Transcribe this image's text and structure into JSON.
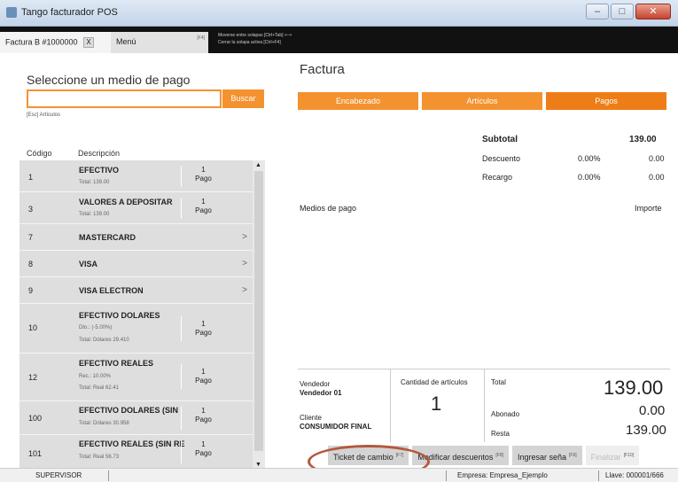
{
  "window": {
    "title": "Tango facturador POS",
    "buttons": [
      "–",
      "□",
      "✕"
    ]
  },
  "tabs": {
    "active_label": "Factura B #1000000",
    "close_glyph": "X",
    "menu_label": "Menú",
    "menu_key": "[F4]",
    "hint_line1": "Moverse entre solapas [Ctrl+Tab] ⇐⇒",
    "hint_line2": "Cerrar la solapa activa [Ctrl+F4]"
  },
  "left": {
    "heading": "Seleccione un medio de pago",
    "search_placeholder": "",
    "search_button": "Buscar",
    "hint": "[Esc] Artículos",
    "col_code": "Código",
    "col_desc": "Descripción",
    "rows": [
      {
        "code": "1",
        "desc": "EFECTIVO",
        "det1": "Total: 139.00",
        "det2": "",
        "pago1": "1",
        "pago2": "Pago"
      },
      {
        "code": "3",
        "desc": "VALORES A DEPOSITAR",
        "det1": "Total: 139.00",
        "det2": "",
        "pago1": "1",
        "pago2": "Pago"
      },
      {
        "code": "7",
        "desc": "MASTERCARD",
        "chev": ">"
      },
      {
        "code": "8",
        "desc": "VISA",
        "chev": ">"
      },
      {
        "code": "9",
        "desc": "VISA ELECTRON",
        "chev": ">"
      },
      {
        "code": "10",
        "desc": "EFECTIVO DOLARES",
        "det1": "Dto.: (-5.00%)",
        "det2": "Total: Dólares 29.410",
        "pago1": "1",
        "pago2": "Pago"
      },
      {
        "code": "12",
        "desc": "EFECTIVO REALES",
        "det1": "Rec.: 10.00%",
        "det2": "Total: Real 62.41",
        "pago1": "1",
        "pago2": "Pago"
      },
      {
        "code": "100",
        "desc": "EFECTIVO DOLARES (SIN",
        "det1": "Total: Dólares 30.958",
        "det2": "",
        "pago1": "1",
        "pago2": "Pago"
      },
      {
        "code": "101",
        "desc": "EFECTIVO REALES (SIN RE",
        "det1": "Total: Real 56.73",
        "det2": "",
        "pago1": "1",
        "pago2": "Pago"
      }
    ]
  },
  "right": {
    "heading": "Factura",
    "tabs": [
      "Encabezado",
      "Artículos",
      "Pagos"
    ],
    "subtotal_label": "Subtotal",
    "subtotal_value": "139.00",
    "descuento_label": "Descuento",
    "descuento_pct": "0.00%",
    "descuento_value": "0.00",
    "recargo_label": "Recargo",
    "recargo_pct": "0.00%",
    "recargo_value": "0.00",
    "medios_label": "Medios de pago",
    "importe_label": "Importe",
    "vendedor_label": "Vendedor",
    "vendedor_value": "Vendedor 01",
    "cliente_label": "Cliente",
    "cliente_value": "CONSUMIDOR FINAL",
    "cantidad_label": "Cantidad de artículos",
    "cantidad_value": "1",
    "total_label": "Total",
    "total_value": "139.00",
    "abonado_label": "Abonado",
    "abonado_value": "0.00",
    "resta_label": "Resta",
    "resta_value": "139.00",
    "actions": [
      {
        "label": "Ticket de cambio",
        "key": "[F7]"
      },
      {
        "label": "Modificar descuentos",
        "key": "[F8]"
      },
      {
        "label": "Ingresar seña",
        "key": "[F9]"
      },
      {
        "label": "Finalizar",
        "key": "[F10]"
      }
    ]
  },
  "status": {
    "user": "SUPERVISOR",
    "empresa": "Empresa: Empresa_Ejemplo",
    "llave": "Llave: 000001/666"
  },
  "colors": {
    "accent": "#f3922f",
    "accent_dark": "#ef7d17",
    "highlight_oval": "#b5573d"
  }
}
